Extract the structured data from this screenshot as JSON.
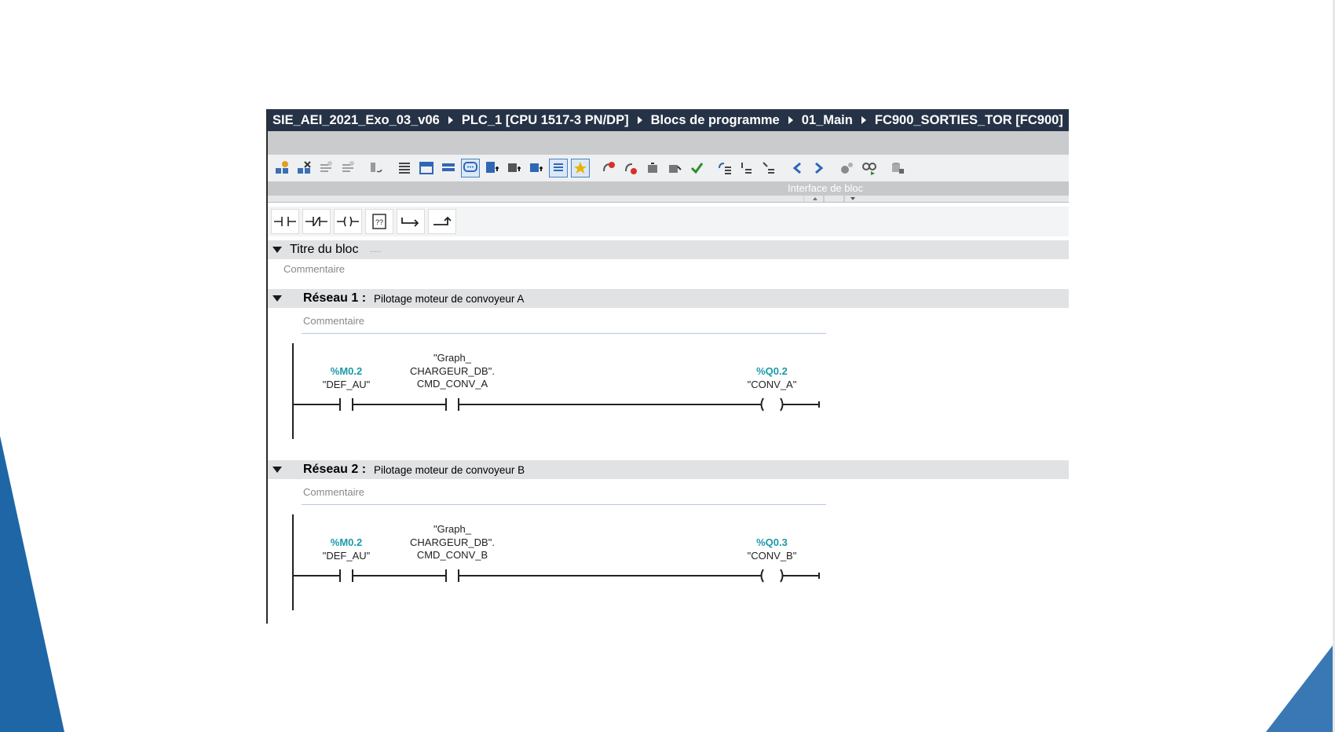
{
  "breadcrumb": {
    "items": [
      "SIE_AEI_2021_Exo_03_v06",
      "PLC_1 [CPU 1517-3 PN/DP]",
      "Blocs de programme",
      "01_Main",
      "FC900_SORTIES_TOR [FC900]"
    ]
  },
  "interface_bar": {
    "label": "Interface de bloc"
  },
  "block": {
    "title_label": "Titre du bloc",
    "title_dots": ".....",
    "comment": "Commentaire"
  },
  "networks": [
    {
      "label": "Réseau 1 :",
      "title": "Pilotage moteur de convoyeur A",
      "comment": "Commentaire",
      "contact1": {
        "address": "%M0.2",
        "tag": "\"DEF_AU\""
      },
      "contact2": {
        "line1": "\"Graph_",
        "line2": "CHARGEUR_DB\".",
        "line3": "CMD_CONV_A"
      },
      "coil": {
        "address": "%Q0.2",
        "tag": "\"CONV_A\""
      }
    },
    {
      "label": "Réseau 2 :",
      "title": "Pilotage moteur de convoyeur B",
      "comment": "Commentaire",
      "contact1": {
        "address": "%M0.2",
        "tag": "\"DEF_AU\""
      },
      "contact2": {
        "line1": "\"Graph_",
        "line2": "CHARGEUR_DB\".",
        "line3": "CMD_CONV_B"
      },
      "coil": {
        "address": "%Q0.3",
        "tag": "\"CONV_B\""
      }
    }
  ],
  "colors": {
    "breadcrumb_bg": "#263347",
    "address_teal": "#1a9aa8",
    "deco_blue": "#1e66a6"
  }
}
